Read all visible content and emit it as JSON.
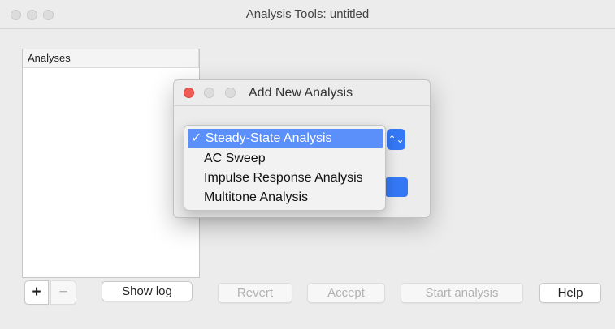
{
  "window": {
    "title": "Analysis Tools: untitled"
  },
  "list": {
    "header": "Analyses"
  },
  "toolbar": {
    "add_label": "+",
    "remove_label": "−",
    "show_log_label": "Show log",
    "revert_label": "Revert",
    "accept_label": "Accept",
    "start_label": "Start analysis",
    "help_label": "Help"
  },
  "dialog": {
    "title": "Add New Analysis",
    "stepper_icon": "⌃⌄"
  },
  "menu": {
    "items": [
      {
        "label": "✓ Steady-State Analysis",
        "selected": true
      },
      {
        "label": "AC Sweep",
        "selected": false
      },
      {
        "label": "Impulse Response Analysis",
        "selected": false
      },
      {
        "label": "Multitone Analysis",
        "selected": false
      }
    ]
  },
  "colors": {
    "accent": "#3478f6",
    "selected_item": "#5b8ff9",
    "close": "#ee5c55"
  }
}
